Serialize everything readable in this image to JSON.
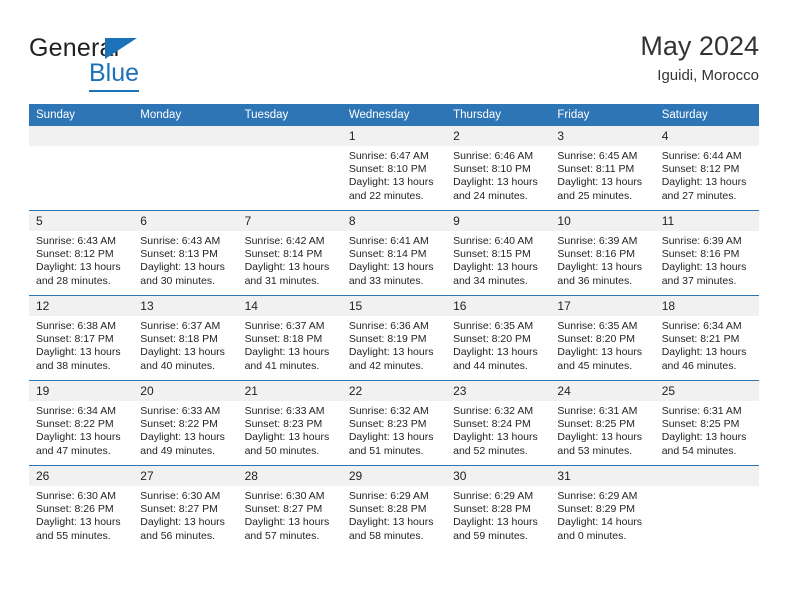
{
  "brand": {
    "name_part1": "General",
    "name_part2": "Blue",
    "logo_icon": "blue-triangle-icon"
  },
  "header": {
    "title": "May 2024",
    "subtitle": "Iguidi, Morocco"
  },
  "colors": {
    "header_blue": "#2e75b6",
    "brand_blue": "#1b72b8",
    "daynum_band": "#f1f1f1",
    "text": "#231f20"
  },
  "weekdays": [
    "Sunday",
    "Monday",
    "Tuesday",
    "Wednesday",
    "Thursday",
    "Friday",
    "Saturday"
  ],
  "weeks": [
    [
      {
        "day": "",
        "empty": true,
        "sunrise": "",
        "sunset": "",
        "daylight1": "",
        "daylight2": ""
      },
      {
        "day": "",
        "empty": true,
        "sunrise": "",
        "sunset": "",
        "daylight1": "",
        "daylight2": ""
      },
      {
        "day": "",
        "empty": true,
        "sunrise": "",
        "sunset": "",
        "daylight1": "",
        "daylight2": ""
      },
      {
        "day": "1",
        "empty": false,
        "sunrise": "Sunrise: 6:47 AM",
        "sunset": "Sunset: 8:10 PM",
        "daylight1": "Daylight: 13 hours",
        "daylight2": "and 22 minutes."
      },
      {
        "day": "2",
        "empty": false,
        "sunrise": "Sunrise: 6:46 AM",
        "sunset": "Sunset: 8:10 PM",
        "daylight1": "Daylight: 13 hours",
        "daylight2": "and 24 minutes."
      },
      {
        "day": "3",
        "empty": false,
        "sunrise": "Sunrise: 6:45 AM",
        "sunset": "Sunset: 8:11 PM",
        "daylight1": "Daylight: 13 hours",
        "daylight2": "and 25 minutes."
      },
      {
        "day": "4",
        "empty": false,
        "sunrise": "Sunrise: 6:44 AM",
        "sunset": "Sunset: 8:12 PM",
        "daylight1": "Daylight: 13 hours",
        "daylight2": "and 27 minutes."
      }
    ],
    [
      {
        "day": "5",
        "empty": false,
        "sunrise": "Sunrise: 6:43 AM",
        "sunset": "Sunset: 8:12 PM",
        "daylight1": "Daylight: 13 hours",
        "daylight2": "and 28 minutes."
      },
      {
        "day": "6",
        "empty": false,
        "sunrise": "Sunrise: 6:43 AM",
        "sunset": "Sunset: 8:13 PM",
        "daylight1": "Daylight: 13 hours",
        "daylight2": "and 30 minutes."
      },
      {
        "day": "7",
        "empty": false,
        "sunrise": "Sunrise: 6:42 AM",
        "sunset": "Sunset: 8:14 PM",
        "daylight1": "Daylight: 13 hours",
        "daylight2": "and 31 minutes."
      },
      {
        "day": "8",
        "empty": false,
        "sunrise": "Sunrise: 6:41 AM",
        "sunset": "Sunset: 8:14 PM",
        "daylight1": "Daylight: 13 hours",
        "daylight2": "and 33 minutes."
      },
      {
        "day": "9",
        "empty": false,
        "sunrise": "Sunrise: 6:40 AM",
        "sunset": "Sunset: 8:15 PM",
        "daylight1": "Daylight: 13 hours",
        "daylight2": "and 34 minutes."
      },
      {
        "day": "10",
        "empty": false,
        "sunrise": "Sunrise: 6:39 AM",
        "sunset": "Sunset: 8:16 PM",
        "daylight1": "Daylight: 13 hours",
        "daylight2": "and 36 minutes."
      },
      {
        "day": "11",
        "empty": false,
        "sunrise": "Sunrise: 6:39 AM",
        "sunset": "Sunset: 8:16 PM",
        "daylight1": "Daylight: 13 hours",
        "daylight2": "and 37 minutes."
      }
    ],
    [
      {
        "day": "12",
        "empty": false,
        "sunrise": "Sunrise: 6:38 AM",
        "sunset": "Sunset: 8:17 PM",
        "daylight1": "Daylight: 13 hours",
        "daylight2": "and 38 minutes."
      },
      {
        "day": "13",
        "empty": false,
        "sunrise": "Sunrise: 6:37 AM",
        "sunset": "Sunset: 8:18 PM",
        "daylight1": "Daylight: 13 hours",
        "daylight2": "and 40 minutes."
      },
      {
        "day": "14",
        "empty": false,
        "sunrise": "Sunrise: 6:37 AM",
        "sunset": "Sunset: 8:18 PM",
        "daylight1": "Daylight: 13 hours",
        "daylight2": "and 41 minutes."
      },
      {
        "day": "15",
        "empty": false,
        "sunrise": "Sunrise: 6:36 AM",
        "sunset": "Sunset: 8:19 PM",
        "daylight1": "Daylight: 13 hours",
        "daylight2": "and 42 minutes."
      },
      {
        "day": "16",
        "empty": false,
        "sunrise": "Sunrise: 6:35 AM",
        "sunset": "Sunset: 8:20 PM",
        "daylight1": "Daylight: 13 hours",
        "daylight2": "and 44 minutes."
      },
      {
        "day": "17",
        "empty": false,
        "sunrise": "Sunrise: 6:35 AM",
        "sunset": "Sunset: 8:20 PM",
        "daylight1": "Daylight: 13 hours",
        "daylight2": "and 45 minutes."
      },
      {
        "day": "18",
        "empty": false,
        "sunrise": "Sunrise: 6:34 AM",
        "sunset": "Sunset: 8:21 PM",
        "daylight1": "Daylight: 13 hours",
        "daylight2": "and 46 minutes."
      }
    ],
    [
      {
        "day": "19",
        "empty": false,
        "sunrise": "Sunrise: 6:34 AM",
        "sunset": "Sunset: 8:22 PM",
        "daylight1": "Daylight: 13 hours",
        "daylight2": "and 47 minutes."
      },
      {
        "day": "20",
        "empty": false,
        "sunrise": "Sunrise: 6:33 AM",
        "sunset": "Sunset: 8:22 PM",
        "daylight1": "Daylight: 13 hours",
        "daylight2": "and 49 minutes."
      },
      {
        "day": "21",
        "empty": false,
        "sunrise": "Sunrise: 6:33 AM",
        "sunset": "Sunset: 8:23 PM",
        "daylight1": "Daylight: 13 hours",
        "daylight2": "and 50 minutes."
      },
      {
        "day": "22",
        "empty": false,
        "sunrise": "Sunrise: 6:32 AM",
        "sunset": "Sunset: 8:23 PM",
        "daylight1": "Daylight: 13 hours",
        "daylight2": "and 51 minutes."
      },
      {
        "day": "23",
        "empty": false,
        "sunrise": "Sunrise: 6:32 AM",
        "sunset": "Sunset: 8:24 PM",
        "daylight1": "Daylight: 13 hours",
        "daylight2": "and 52 minutes."
      },
      {
        "day": "24",
        "empty": false,
        "sunrise": "Sunrise: 6:31 AM",
        "sunset": "Sunset: 8:25 PM",
        "daylight1": "Daylight: 13 hours",
        "daylight2": "and 53 minutes."
      },
      {
        "day": "25",
        "empty": false,
        "sunrise": "Sunrise: 6:31 AM",
        "sunset": "Sunset: 8:25 PM",
        "daylight1": "Daylight: 13 hours",
        "daylight2": "and 54 minutes."
      }
    ],
    [
      {
        "day": "26",
        "empty": false,
        "sunrise": "Sunrise: 6:30 AM",
        "sunset": "Sunset: 8:26 PM",
        "daylight1": "Daylight: 13 hours",
        "daylight2": "and 55 minutes."
      },
      {
        "day": "27",
        "empty": false,
        "sunrise": "Sunrise: 6:30 AM",
        "sunset": "Sunset: 8:27 PM",
        "daylight1": "Daylight: 13 hours",
        "daylight2": "and 56 minutes."
      },
      {
        "day": "28",
        "empty": false,
        "sunrise": "Sunrise: 6:30 AM",
        "sunset": "Sunset: 8:27 PM",
        "daylight1": "Daylight: 13 hours",
        "daylight2": "and 57 minutes."
      },
      {
        "day": "29",
        "empty": false,
        "sunrise": "Sunrise: 6:29 AM",
        "sunset": "Sunset: 8:28 PM",
        "daylight1": "Daylight: 13 hours",
        "daylight2": "and 58 minutes."
      },
      {
        "day": "30",
        "empty": false,
        "sunrise": "Sunrise: 6:29 AM",
        "sunset": "Sunset: 8:28 PM",
        "daylight1": "Daylight: 13 hours",
        "daylight2": "and 59 minutes."
      },
      {
        "day": "31",
        "empty": false,
        "sunrise": "Sunrise: 6:29 AM",
        "sunset": "Sunset: 8:29 PM",
        "daylight1": "Daylight: 14 hours",
        "daylight2": "and 0 minutes."
      },
      {
        "day": "",
        "empty": true,
        "sunrise": "",
        "sunset": "",
        "daylight1": "",
        "daylight2": ""
      }
    ]
  ]
}
